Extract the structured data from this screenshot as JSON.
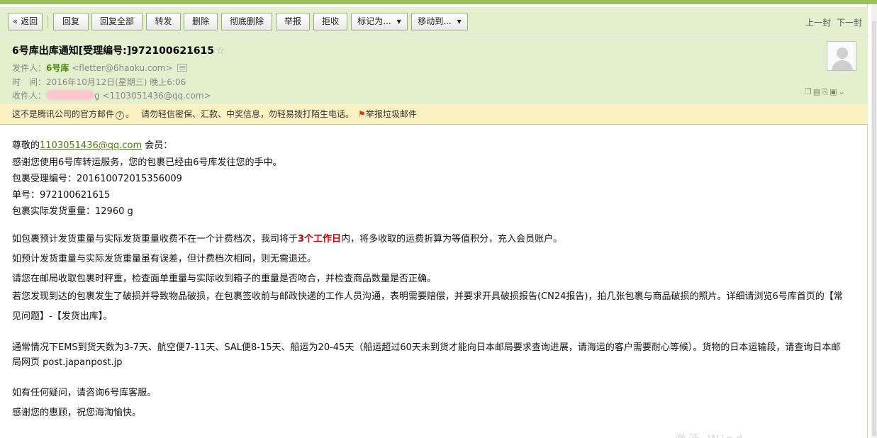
{
  "toolbar": {
    "back": "« 返回",
    "reply": "回复",
    "reply_all": "回复全部",
    "forward": "转发",
    "delete": "删除",
    "delete_perm": "彻底删除",
    "report": "举报",
    "reject": "拒收",
    "mark_as": "标记为...",
    "move_to": "移动到...",
    "prev": "上一封",
    "next": "下一封"
  },
  "header": {
    "subject": "6号库出库通知[受理编号:]972100621615",
    "from_label": "发件人：",
    "from_name": "6号库",
    "from_addr": "<fletter@6haoku.com>",
    "time_label": "时　间：",
    "time_value": "2016年10月12日(星期三) 晚上6:06",
    "to_label": "收件人：",
    "to_partial": "g",
    "to_addr": "<1103051436@qq.com>"
  },
  "notice": {
    "text": "这不是腾讯公司的官方邮件",
    "help": "?",
    "warning": "请勿轻信密保、汇款、中奖信息，勿轻易拨打陌生电话。",
    "report_spam": "举报垃圾邮件"
  },
  "body": {
    "greeting_prefix": "尊敬的",
    "greeting_email": "1103051436@qq.com",
    "greeting_suffix": " 会员：",
    "line1": "感谢您使用6号库转运服务，您的包裹已经由6号库发往您的手中。",
    "line2": "包裹受理编号：201610072015356009",
    "line3": "单号：972100621615",
    "line4": "包裹实际发货重量：12960 g",
    "p1_a": "如包裹预计发货重量与实际发货重量收费不在一个计费档次，我司将于",
    "p1_red": "3个工作日",
    "p1_b": "内，将多收取的运费折算为等值积分，充入会员账户。",
    "p2": "如预计发货重量与实际发货重量虽有误差，但计费档次相同，则无需退还。",
    "p3": "请您在邮局收取包裹时秤重，检查面单重量与实际收到箱子的重量是否吻合，并检查商品数量是否正确。",
    "p4": "若您发现到达的包裹发生了破损并导致物品破损，在包裹签收前与邮政快递的工作人员沟通，表明需要赔偿，并要求开具破损报告(CN24报告)，拍几张包裹与商品破损的照片。详细请浏览6号库首页的【常见问题】-【发货出库】。",
    "p5": "通常情况下EMS到货天数为3-7天、航空便7-11天、SAL便8-15天、船运为20-45天（船运超过60天未到货才能向日本邮局要求查询进展，请海运的客户需要耐心等候）。货物的日本运输段，请查询日本邮局网页 post.japanpost.jp",
    "p6": "如有任何疑问，请咨询6号库客服。",
    "p7": "感谢您的惠顾，祝您海淘愉快。"
  },
  "watermark": "激活 Wind"
}
